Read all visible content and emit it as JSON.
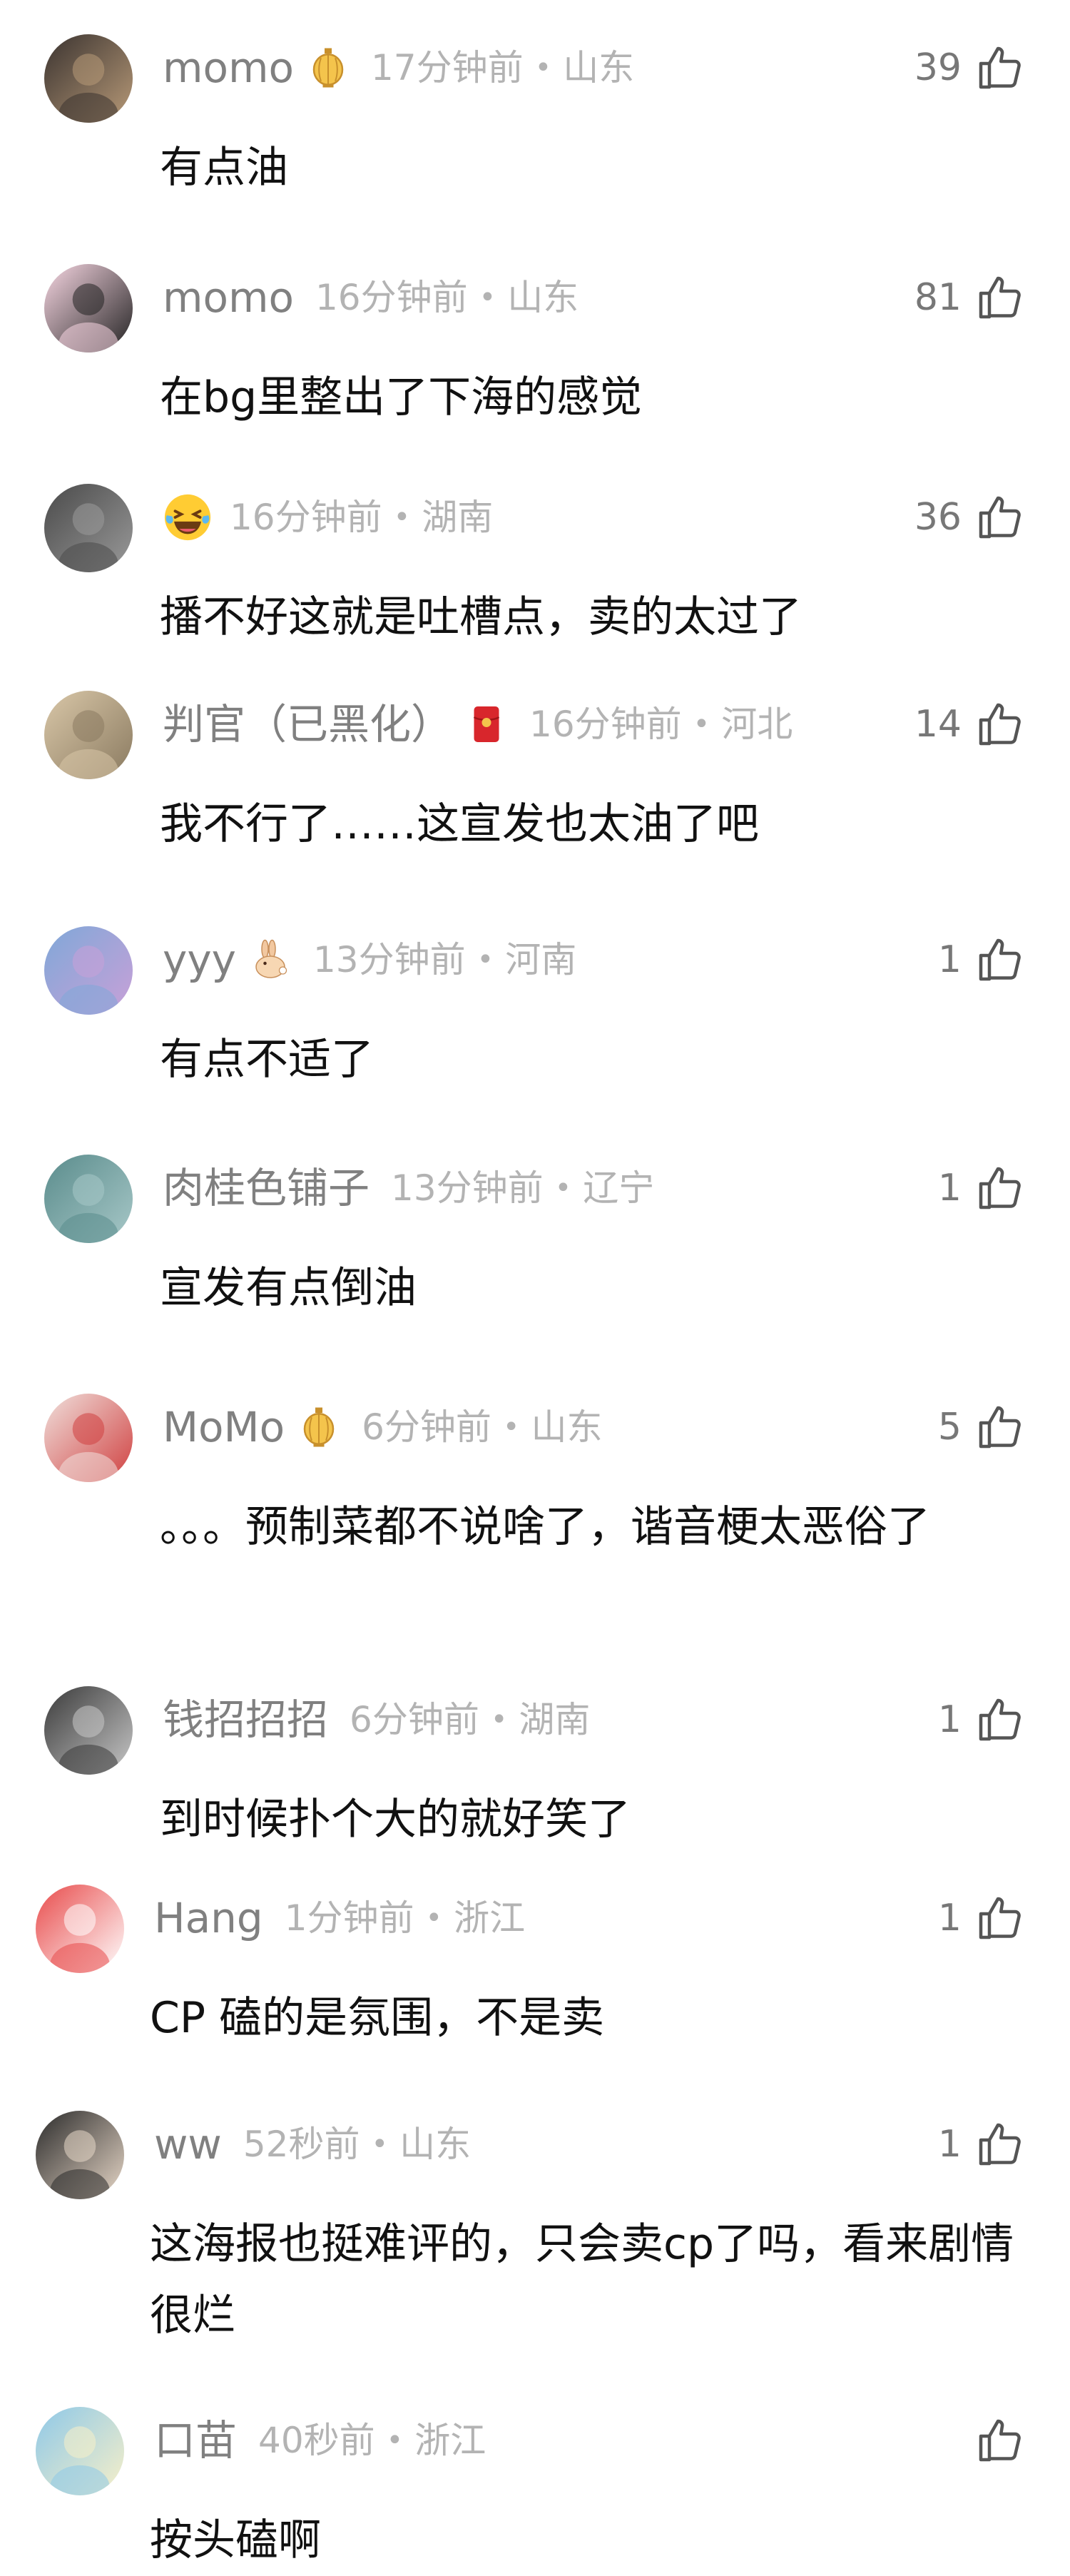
{
  "comments": [
    {
      "username": "momo",
      "badge": "lantern-badge",
      "time": "17分钟前",
      "location": "山东",
      "likes": "39",
      "text": "有点油",
      "avatar_colors": [
        "#3a3330",
        "#b89a78"
      ]
    },
    {
      "username": "momo",
      "badge": "",
      "time": "16分钟前",
      "location": "山东",
      "likes": "81",
      "text": "在bg里整出了下海的感觉",
      "avatar_colors": [
        "#f7d6e2",
        "#222222"
      ]
    },
    {
      "username": "",
      "badge": "laughing-emoji",
      "time": "16分钟前",
      "location": "湖南",
      "likes": "36",
      "text": "播不好这就是吐槽点，卖的太过了",
      "avatar_colors": [
        "#4a4a4a",
        "#9a9a9a"
      ]
    },
    {
      "username": "判官（已黑化）",
      "badge": "red-envelope-badge",
      "time": "16分钟前",
      "location": "河北",
      "likes": "14",
      "text": "我不行了……这宣发也太油了吧",
      "avatar_colors": [
        "#d9c7a8",
        "#8a7a60"
      ]
    },
    {
      "username": "yyy",
      "badge": "rabbit-badge",
      "time": "13分钟前",
      "location": "河南",
      "likes": "1",
      "text": "有点不适了",
      "avatar_colors": [
        "#7fa8d8",
        "#c9a0d8"
      ]
    },
    {
      "username": "肉桂色铺子",
      "badge": "",
      "time": "13分钟前",
      "location": "辽宁",
      "likes": "1",
      "text": "宣发有点倒油",
      "avatar_colors": [
        "#5a8c8c",
        "#a8c8c8"
      ]
    },
    {
      "username": "MoMo",
      "badge": "lantern-badge",
      "time": "6分钟前",
      "location": "山东",
      "likes": "5",
      "text": "。。。预制菜都不说啥了，谐音梗太恶俗了",
      "avatar_colors": [
        "#f0e0dc",
        "#d04040"
      ]
    },
    {
      "username": "钱招招招",
      "badge": "",
      "time": "6分钟前",
      "location": "湖南",
      "likes": "1",
      "text": "到时候扑个大的就好笑了",
      "avatar_colors": [
        "#3a3a3a",
        "#c8c8c8"
      ]
    },
    {
      "username": "Hang",
      "badge": "",
      "time": "1分钟前",
      "location": "浙江",
      "likes": "1",
      "text": "CP 磕的是氛围，不是卖",
      "avatar_colors": [
        "#e84a4a",
        "#ffffff"
      ]
    },
    {
      "username": "ww",
      "badge": "",
      "time": "52秒前",
      "location": "山东",
      "likes": "1",
      "text": "这海报也挺难评的，只会卖cp了吗，看来剧情很烂",
      "avatar_colors": [
        "#2a2a2a",
        "#e8d8c8"
      ]
    },
    {
      "username": "口苗",
      "badge": "",
      "time": "40秒前",
      "location": "浙江",
      "likes": "",
      "text": "按头磕啊",
      "avatar_colors": [
        "#8ec8e8",
        "#f8f0c8"
      ]
    }
  ]
}
